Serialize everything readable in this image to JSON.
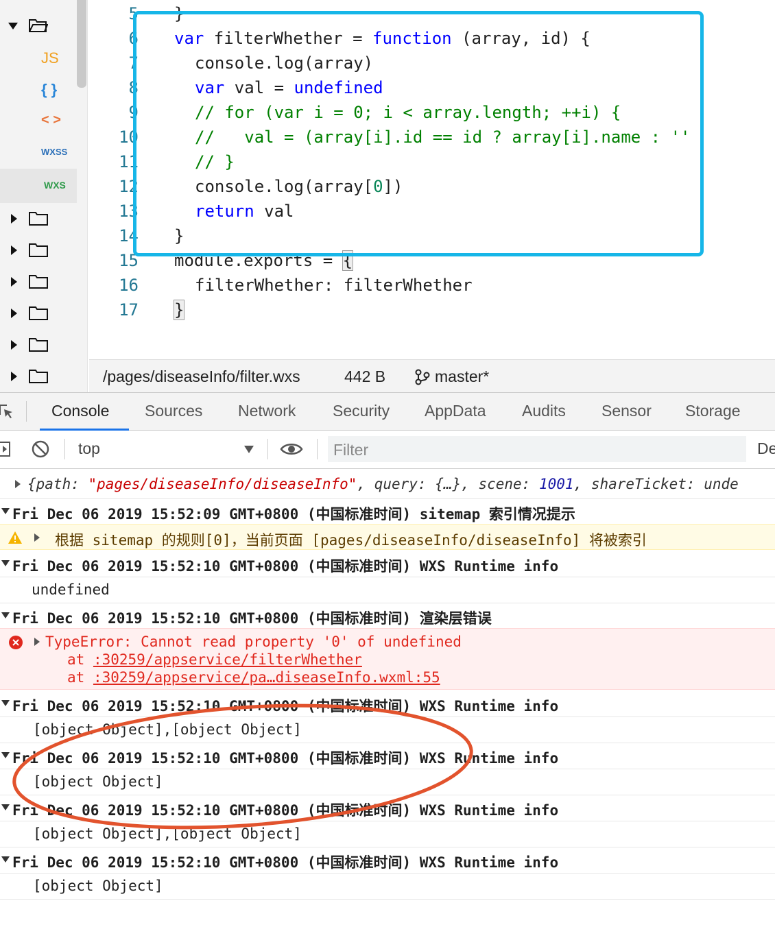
{
  "editor": {
    "line_numbers": [
      "5",
      "6",
      "7",
      "8",
      "9",
      "10",
      "11",
      "12",
      "13",
      "14",
      "15",
      "16",
      "17"
    ],
    "lines": {
      "l5": "}",
      "l6_kw1": "var",
      "l6_a": " filterWhether = ",
      "l6_kw2": "function",
      "l6_b": " (array, id) {",
      "l7": "console.log(array)",
      "l8_kw": "var",
      "l8_a": " val = ",
      "l8_kw2": "undefined",
      "l9": "// for (var i = 0; i < array.length; ++i) {",
      "l10": "//   val = (array[i].id == id ? array[i].name : ''",
      "l11": "// }",
      "l12_a": "console.log(array[",
      "l12_n": "0",
      "l12_b": "])",
      "l13_kw": "return",
      "l13_a": " val",
      "l14": "}",
      "l15_a": "module.exports = ",
      "l15_b": "{",
      "l16": "filterWhether: filterWhether",
      "l17": "}"
    }
  },
  "sidebar": {
    "file_types": [
      "JS",
      "{ }",
      "< >",
      "WXSS",
      "WXS"
    ]
  },
  "status": {
    "path": "/pages/diseaseInfo/filter.wxs",
    "size": "442 B",
    "branch": "master*"
  },
  "devtools": {
    "tabs": [
      "Console",
      "Sources",
      "Network",
      "Security",
      "AppData",
      "Audits",
      "Sensor",
      "Storage"
    ],
    "context": "top",
    "filter_placeholder": "Filter",
    "levels_label": "De"
  },
  "console": {
    "obj_row": {
      "p1": "{path: ",
      "p2": "\"pages/diseaseInfo/diseaseInfo\"",
      "p3": ", query: {…}, scene: ",
      "p4": "1001",
      "p5": ", shareTicket: unde"
    },
    "rows": [
      "Fri Dec 06 2019 15:52:09 GMT+0800 (中国标准时间) sitemap 索引情况提示",
      "根据 sitemap 的规则[0]，当前页面 [pages/diseaseInfo/diseaseInfo] 将被索引",
      "Fri Dec 06 2019 15:52:10 GMT+0800 (中国标准时间) WXS Runtime info",
      "undefined",
      "Fri Dec 06 2019 15:52:10 GMT+0800 (中国标准时间) 渲染层错误",
      "TypeError: Cannot read property '0' of undefined",
      "at ",
      ":30259/appservice/filterWhether",
      "at ",
      ":30259/appservice/pa…diseaseInfo.wxml:55",
      "Fri Dec 06 2019 15:52:10 GMT+0800 (中国标准时间) WXS Runtime info",
      "[object Object],[object Object]",
      "Fri Dec 06 2019 15:52:10 GMT+0800 (中国标准时间) WXS Runtime info",
      "[object Object]",
      "Fri Dec 06 2019 15:52:10 GMT+0800 (中国标准时间) WXS Runtime info",
      "[object Object],[object Object]",
      "Fri Dec 06 2019 15:52:10 GMT+0800 (中国标准时间) WXS Runtime info",
      "[object Object]"
    ]
  },
  "colors": {
    "annotation_box": "#16b6e8",
    "annotation_ellipse": "#e2532d",
    "error_text": "#e0281e",
    "string": "#c80000",
    "number": "#1a1aa6"
  }
}
